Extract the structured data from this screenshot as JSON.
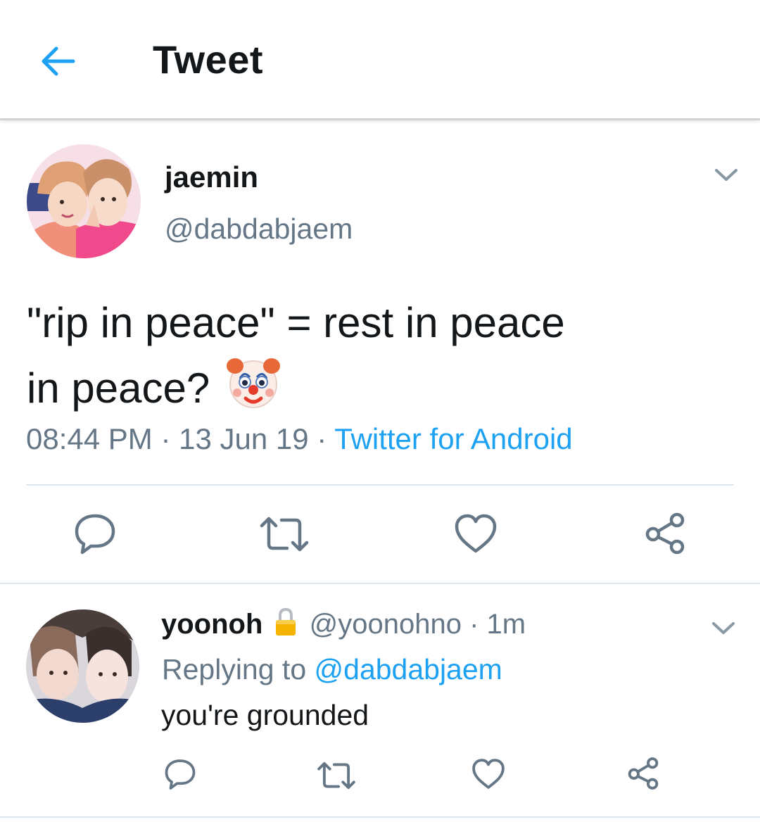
{
  "header": {
    "title": "Tweet"
  },
  "tweet": {
    "display_name": "jaemin",
    "handle": "@dabdabjaem",
    "text_line1": "\"rip in peace\" = rest in peace",
    "text_line2": "in peace?",
    "emoji": "clown-face",
    "time": "08:44 PM",
    "dot1": " · ",
    "date": "13 Jun 19",
    "dot2": " · ",
    "source": "Twitter for Android"
  },
  "reply": {
    "display_name": "yoonoh",
    "lock": "🔒",
    "handle": "@yoonohno",
    "dot": " · ",
    "age": "1m",
    "replying_prefix": "Replying to ",
    "replying_to": "@dabdabjaem",
    "text": "you're grounded"
  },
  "icons": [
    "back-arrow-icon",
    "chevron-down-icon",
    "reply-icon",
    "retweet-icon",
    "like-icon",
    "share-icon",
    "lock-icon"
  ],
  "colors": {
    "accent": "#1da1f2",
    "text": "#14171a",
    "muted": "#657786",
    "divider": "#e1e8ed"
  }
}
